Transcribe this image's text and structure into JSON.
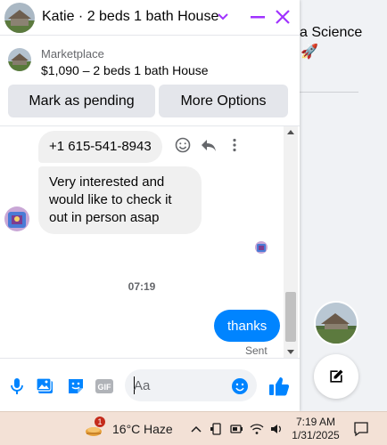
{
  "background_page": {
    "partial_text": "a Science",
    "rocket_emoji": "🚀"
  },
  "chat": {
    "title": "Katie · 2 beds 1 bath House",
    "marketplace_label": "Marketplace",
    "listing_detail": "$1,090 – 2 beds 1 bath House",
    "buttons": {
      "mark_pending": "Mark as pending",
      "more_options": "More Options"
    },
    "messages": [
      {
        "from": "other",
        "text": "+1 615-541-8943"
      },
      {
        "from": "other",
        "text": "Very interested and would like to check it out in person asap"
      },
      {
        "from": "me",
        "text": "thanks"
      }
    ],
    "timestamp": "07:19",
    "status": "Sent",
    "composer": {
      "placeholder": "Aa"
    }
  },
  "taskbar": {
    "weather_temp": "16°C",
    "weather_desc": "Haze",
    "weather_badge": "1",
    "time": "7:19 AM",
    "date": "1/31/2025"
  },
  "colors": {
    "accent": "#0084ff",
    "header_icons": "#a033ff",
    "bubble_in": "#f0f0f0",
    "taskbar": "#f3e1d6"
  }
}
